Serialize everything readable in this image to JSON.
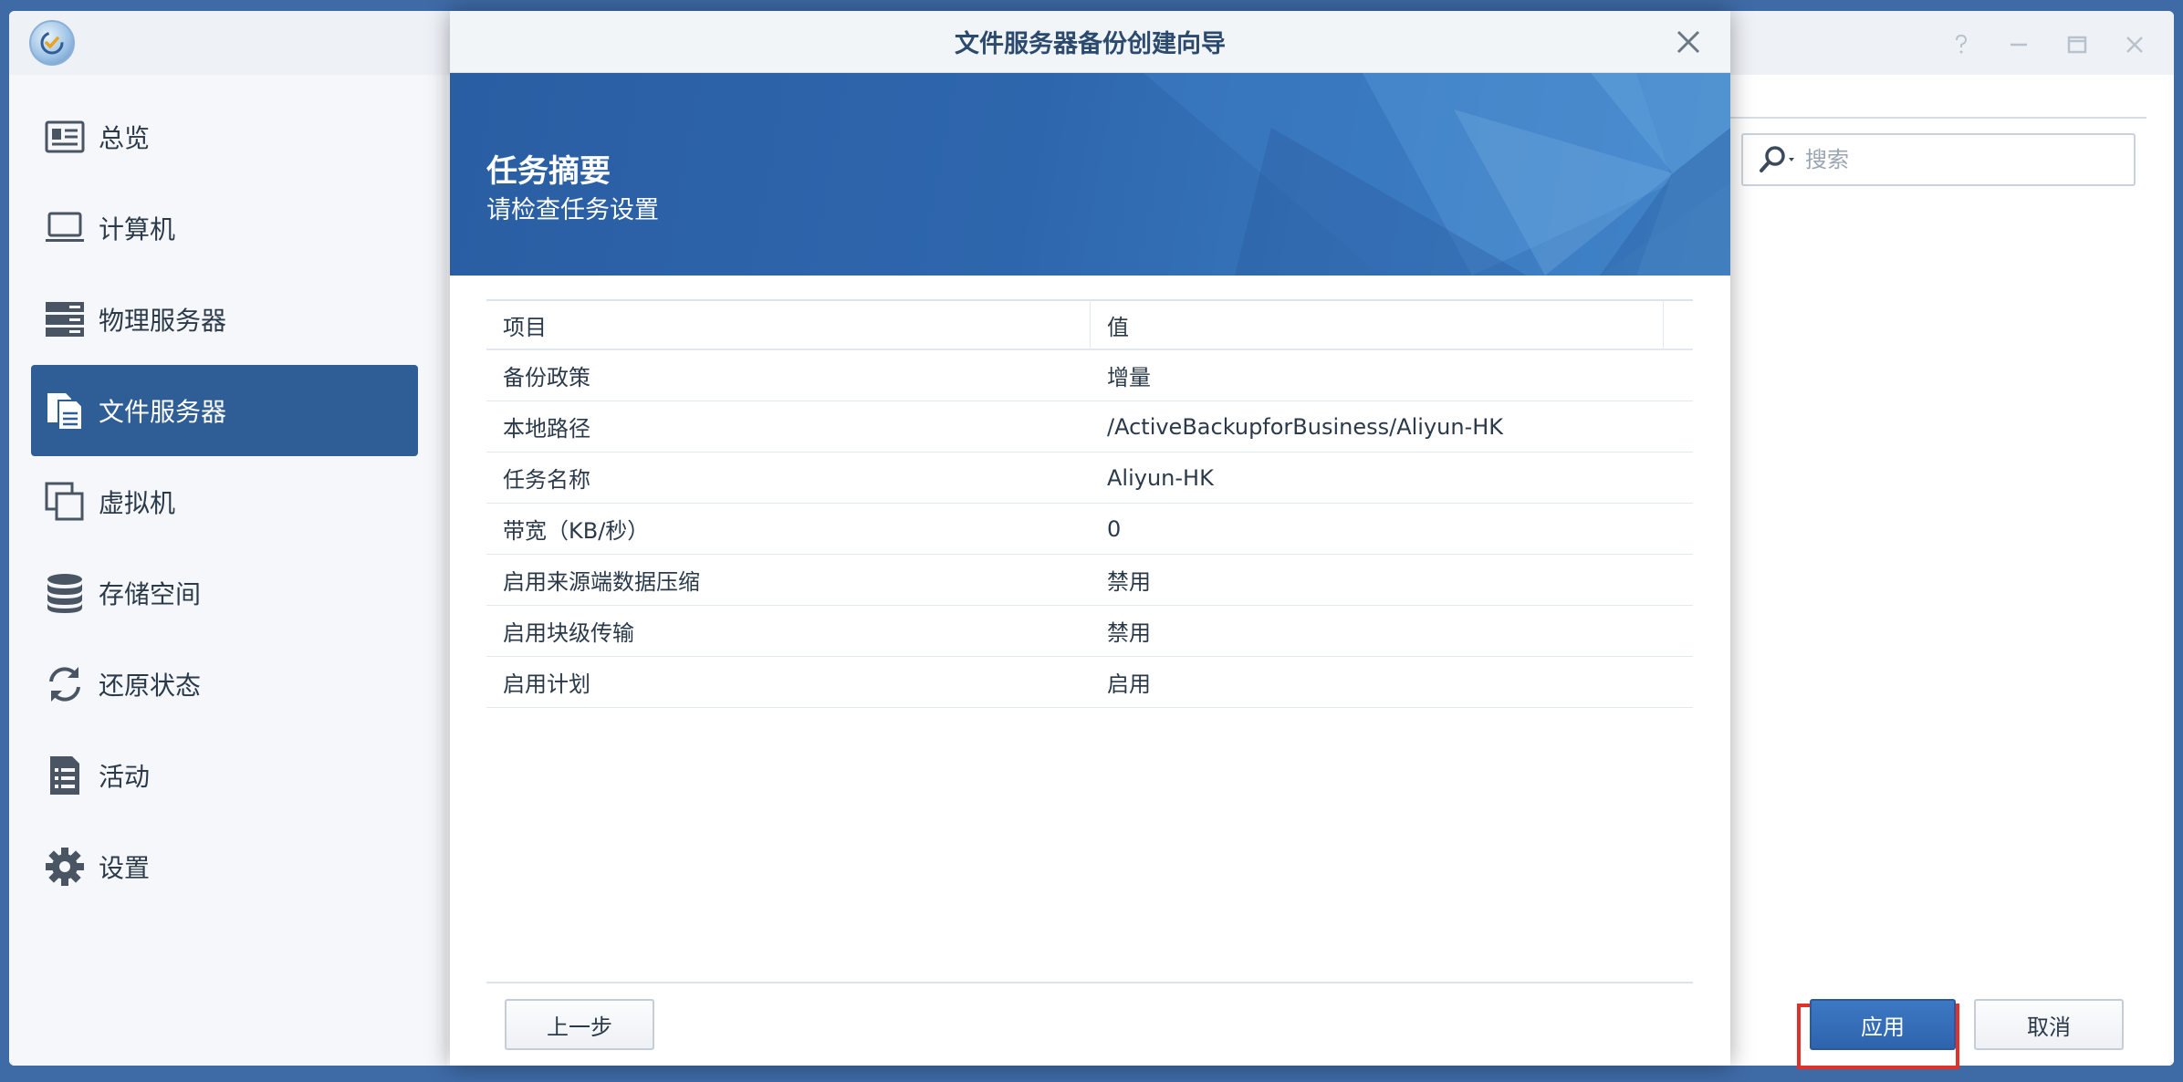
{
  "sidebar": {
    "items": [
      {
        "label": "总览",
        "icon": "overview-icon"
      },
      {
        "label": "计算机",
        "icon": "laptop-icon"
      },
      {
        "label": "物理服务器",
        "icon": "server-icon"
      },
      {
        "label": "文件服务器",
        "icon": "file-server-icon",
        "active": true
      },
      {
        "label": "虚拟机",
        "icon": "virtual-machine-icon"
      },
      {
        "label": "存储空间",
        "icon": "database-icon"
      },
      {
        "label": "还原状态",
        "icon": "restore-icon"
      },
      {
        "label": "活动",
        "icon": "activity-list-icon"
      },
      {
        "label": "设置",
        "icon": "gear-icon"
      }
    ]
  },
  "search": {
    "placeholder": "搜索"
  },
  "window_controls": [
    "help-icon",
    "minimize-icon",
    "maximize-icon",
    "close-icon"
  ],
  "dialog": {
    "title": "文件服务器备份创建向导",
    "banner_title": "任务摘要",
    "banner_subtitle": "请检查任务设置",
    "table": {
      "headers": [
        "项目",
        "值"
      ],
      "rows": [
        [
          "备份政策",
          "增量"
        ],
        [
          "本地路径",
          "/ActiveBackupforBusiness/Aliyun-HK"
        ],
        [
          "任务名称",
          "Aliyun-HK"
        ],
        [
          "带宽（KB/秒）",
          "0"
        ],
        [
          "启用来源端数据压缩",
          "禁用"
        ],
        [
          "启用块级传输",
          "禁用"
        ],
        [
          "启用计划",
          "启用"
        ]
      ]
    },
    "buttons": {
      "back": "上一步",
      "apply": "应用",
      "cancel": "取消"
    }
  },
  "colors": {
    "desktop": "#3e6aa6",
    "sidebar_active": "#2f5d95",
    "banner": "#2e66ad",
    "primary_button": "#2f64ad",
    "highlight": "#e0312a"
  }
}
